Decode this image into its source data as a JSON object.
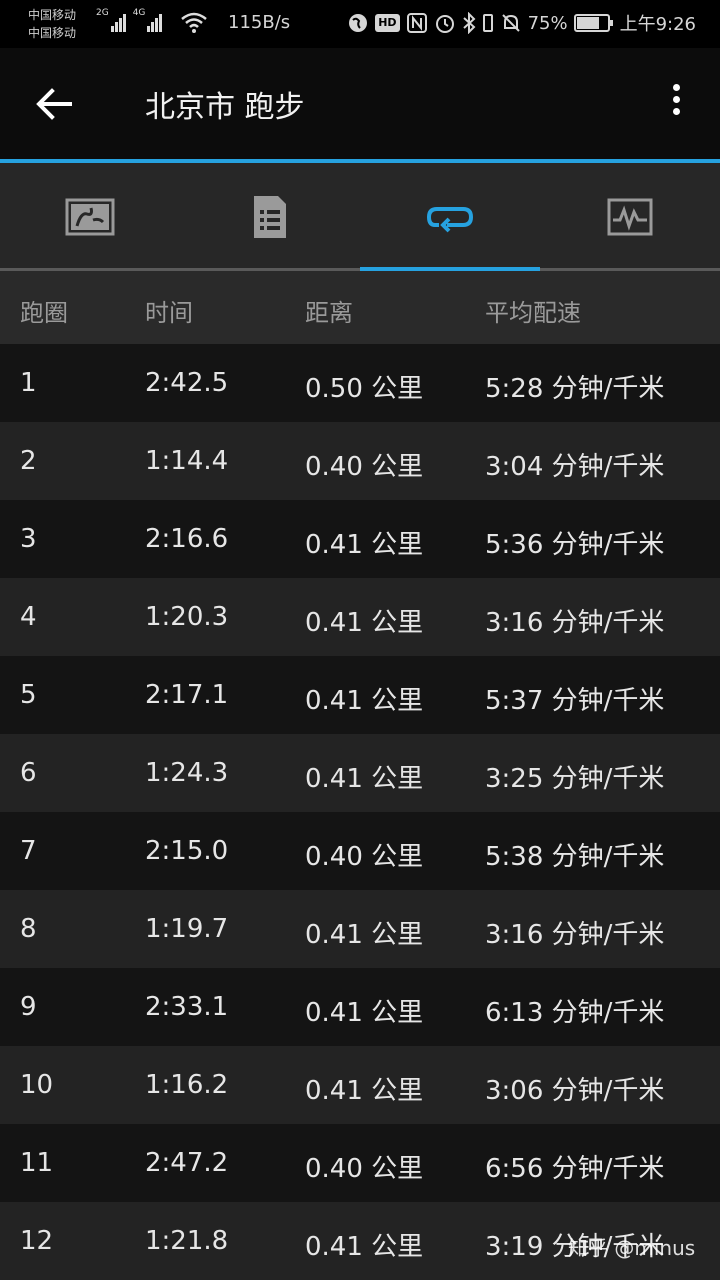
{
  "status_bar": {
    "carrier_1": "中国移动",
    "carrier_2": "中国移动",
    "network_1": "2G",
    "network_2": "4G",
    "speed": "115B/s",
    "battery_pct": "75%",
    "battery_level": 0.75,
    "time": "上午9:26",
    "hd": "HD",
    "icons": [
      "signal-icon",
      "wifi-icon",
      "globe-icon",
      "hd-icon",
      "nfc-icon",
      "alarm-icon",
      "bluetooth-icon",
      "mute-icon",
      "battery-icon"
    ]
  },
  "toolbar": {
    "title": "北京市 跑步",
    "back_icon": "arrow-left-icon",
    "menu_icon": "more-vertical-icon"
  },
  "tabs": [
    {
      "icon": "map-icon",
      "active": false
    },
    {
      "icon": "details-list-icon",
      "active": false
    },
    {
      "icon": "laps-loop-icon",
      "active": true
    },
    {
      "icon": "activity-graph-icon",
      "active": false
    }
  ],
  "colors": {
    "accent": "#26a2e0",
    "background": "#141414"
  },
  "table": {
    "headers": [
      "跑圈",
      "时间",
      "距离",
      "平均配速"
    ],
    "rows": [
      [
        "1",
        "2:42.5",
        "0.50 公里",
        "5:28 分钟/千米"
      ],
      [
        "2",
        "1:14.4",
        "0.40 公里",
        "3:04 分钟/千米"
      ],
      [
        "3",
        "2:16.6",
        "0.41 公里",
        "5:36 分钟/千米"
      ],
      [
        "4",
        "1:20.3",
        "0.41 公里",
        "3:16 分钟/千米"
      ],
      [
        "5",
        "2:17.1",
        "0.41 公里",
        "5:37 分钟/千米"
      ],
      [
        "6",
        "1:24.3",
        "0.41 公里",
        "3:25 分钟/千米"
      ],
      [
        "7",
        "2:15.0",
        "0.40 公里",
        "5:38 分钟/千米"
      ],
      [
        "8",
        "1:19.7",
        "0.41 公里",
        "3:16 分钟/千米"
      ],
      [
        "9",
        "2:33.1",
        "0.41 公里",
        "6:13 分钟/千米"
      ],
      [
        "10",
        "1:16.2",
        "0.41 公里",
        "3:06 分钟/千米"
      ],
      [
        "11",
        "2:47.2",
        "0.40 公里",
        "6:56 分钟/千米"
      ],
      [
        "12",
        "1:21.8",
        "0.41 公里",
        "3:19 分钟/千米"
      ]
    ]
  },
  "watermark": "知乎 @minus"
}
